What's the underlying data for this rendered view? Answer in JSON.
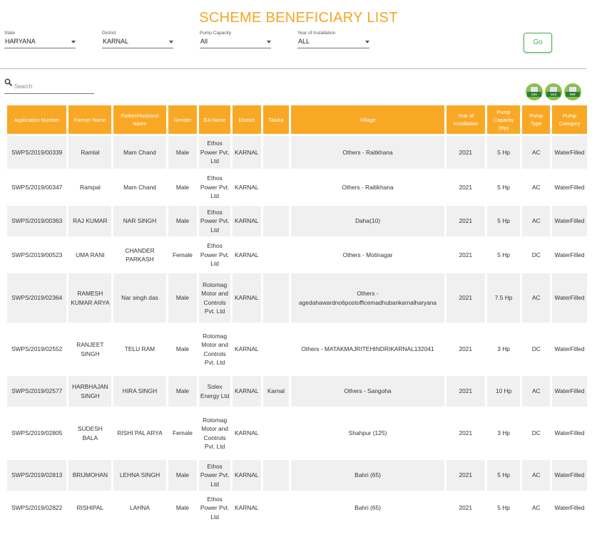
{
  "title": "SCHEME BENEFICIARY LIST",
  "filters": [
    {
      "label": "State",
      "value": "HARYANA"
    },
    {
      "label": "District",
      "value": "KARNAL"
    },
    {
      "label": "Pump Capacity",
      "value": "All"
    },
    {
      "label": "Year of Installation",
      "value": "ALL"
    }
  ],
  "go_label": "Go",
  "search": {
    "placeholder": "Search",
    "icon": "search-icon"
  },
  "exports": [
    {
      "label": "CSV",
      "icon": "csv-file-icon"
    },
    {
      "label": "XLS",
      "icon": "xls-file-icon"
    },
    {
      "label": "PDF",
      "icon": "pdf-file-icon"
    }
  ],
  "colors": {
    "accent": "#f9a825",
    "title": "#f5a623",
    "go_button": "#4caf50",
    "export_badge": "#8bc34a"
  },
  "table": {
    "headers": [
      "Application Number",
      "Farmer Name",
      "Father/Husband Name",
      "Gender",
      "EA Name",
      "District",
      "Taluka",
      "Village",
      "Year of Installation",
      "Pump Capacity (Hp)",
      "Pump Type",
      "Pump Category"
    ],
    "rows": [
      [
        "SWPS/2019/00339",
        "Ramlal",
        "Mam Chand",
        "Male",
        "Ethos Power Pvt. Ltd",
        "KARNAL",
        "",
        "Others - Raitkhana",
        "2021",
        "5 Hp",
        "AC",
        "WaterFilled"
      ],
      [
        "SWPS/2019/00347",
        "Rampal",
        "Mam Chand",
        "Male",
        "Ethos Power Pvt. Ltd",
        "KARNAL",
        "",
        "Others - Raitikhana",
        "2021",
        "5 Hp",
        "AC",
        "WaterFilled"
      ],
      [
        "SWPS/2019/00363",
        "RAJ KUMAR",
        "NAR SINGH",
        "Male",
        "Ethos Power Pvt. Ltd",
        "KARNAL",
        "",
        "Daha(10)",
        "2021",
        "5 Hp",
        "AC",
        "WaterFilled"
      ],
      [
        "SWPS/2019/00523",
        "UMA RANI",
        "CHANDER PARKASH",
        "Female",
        "Ethos Power Pvt. Ltd",
        "KARNAL",
        "",
        "Others - Motinagar",
        "2021",
        "5 Hp",
        "DC",
        "WaterFilled"
      ],
      [
        "SWPS/2019/02364",
        "RAMESH KUMAR ARYA",
        "Nar singh das",
        "Male",
        "Rotomag Motor and Controls Pvt. Ltd",
        "KARNAL",
        "",
        "Others - agedahawardno6postofficemadhubankarnalharyana",
        "2021",
        "7.5 Hp",
        "AC",
        "WaterFilled"
      ],
      [
        "SWPS/2019/02552",
        "RANJEET SINGH",
        "TELU RAM",
        "Male",
        "Rotomag Motor and Controls Pvt. Ltd",
        "KARNAL",
        "",
        "Others - MATAKMAJRITEHINDRIKARNAL132041",
        "2021",
        "3 Hp",
        "DC",
        "WaterFilled"
      ],
      [
        "SWPS/2019/02577",
        "HARBHAJAN SINGH",
        "HIRA SINGH",
        "Male",
        "Solex Energy Ltd",
        "KARNAL",
        "Karnal",
        "Others - Sangoha",
        "2021",
        "10 Hp",
        "AC",
        "WaterFilled"
      ],
      [
        "SWPS/2019/02805",
        "SUDESH BALA",
        "RISHI PAL ARYA",
        "Female",
        "Rotomag Motor and Controls Pvt. Ltd",
        "KARNAL",
        "",
        "Shahpur (125)",
        "2021",
        "3 Hp",
        "DC",
        "WaterFilled"
      ],
      [
        "SWPS/2019/02813",
        "BRIJMOHAN",
        "LEHNA SINGH",
        "Male",
        "Ethos Power Pvt. Ltd",
        "KARNAL",
        "",
        "Bahri (65)",
        "2021",
        "5 Hp",
        "AC",
        "WaterFilled"
      ],
      [
        "SWPS/2019/02822",
        "RISHIPAL",
        "LAHNA",
        "Male",
        "Ethos Power Pvt. Ltd",
        "KARNAL",
        "",
        "Bahri (65)",
        "2021",
        "5 Hp",
        "AC",
        "WaterFilled"
      ]
    ]
  }
}
